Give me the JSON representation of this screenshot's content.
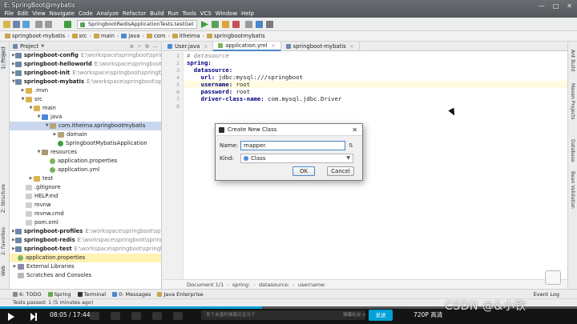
{
  "window": {
    "title": "E: SpringBoot@mybatis",
    "controls": [
      "—",
      "□",
      "✕"
    ]
  },
  "menu": [
    "File",
    "Edit",
    "View",
    "Navigate",
    "Code",
    "Analyze",
    "Refactor",
    "Build",
    "Run",
    "Tools",
    "VCS",
    "Window",
    "Help"
  ],
  "toolbar": {
    "run_config": "SpringbootRedisApplicationTests.testGet"
  },
  "breadcrumb": [
    "springboot-mybatis",
    "src",
    "main",
    "java",
    "com",
    "itheima",
    "springbootmybatis"
  ],
  "left_strip": {
    "project": "1: Project",
    "structure": "Z: Structure",
    "favorites": "2: Favorites",
    "web": "Web"
  },
  "right_strip": {
    "ant": "Ant Build",
    "maven": "Maven Projects",
    "database": "Database",
    "bean": "Bean Validation"
  },
  "project_panel": {
    "header": "Project",
    "tools": [
      "⊕",
      "÷",
      "⚙",
      "—"
    ],
    "rows": [
      {
        "indent": 0,
        "arrow": "▶",
        "icon": "mod",
        "name": "springboot-config",
        "path": "E:\\workspace\\springboot\\springboot",
        "bold": true
      },
      {
        "indent": 0,
        "arrow": "▶",
        "icon": "mod",
        "name": "springboot-helloworld",
        "path": "E:\\workspace\\springboot\\spr",
        "bold": true
      },
      {
        "indent": 0,
        "arrow": "▶",
        "icon": "mod",
        "name": "springboot-init",
        "path": "E:\\workspace\\springboot\\springboot-i",
        "bold": true
      },
      {
        "indent": 0,
        "arrow": "▼",
        "icon": "mod",
        "name": "springboot-mybatis",
        "path": "E:\\workspace\\springboot\\springb",
        "bold": true
      },
      {
        "indent": 1,
        "arrow": "▶",
        "icon": "folder",
        "name": ".mvn",
        "path": ""
      },
      {
        "indent": 1,
        "arrow": "▼",
        "icon": "folder",
        "name": "src",
        "path": ""
      },
      {
        "indent": 2,
        "arrow": "▼",
        "icon": "folder",
        "name": "main",
        "path": ""
      },
      {
        "indent": 3,
        "arrow": "▼",
        "icon": "src",
        "name": "java",
        "path": ""
      },
      {
        "indent": 4,
        "arrow": "▼",
        "icon": "pkg",
        "name": "com.itheima.springbootmybatis",
        "path": "",
        "selected": true
      },
      {
        "indent": 5,
        "arrow": "▶",
        "icon": "pkg",
        "name": "domain",
        "path": ""
      },
      {
        "indent": 5,
        "arrow": "",
        "icon": "cls",
        "name": "SpringbootMybatisApplication",
        "path": ""
      },
      {
        "indent": 3,
        "arrow": "▼",
        "icon": "res",
        "name": "resources",
        "path": ""
      },
      {
        "indent": 4,
        "arrow": "",
        "icon": "leaf",
        "name": "application.properties",
        "path": ""
      },
      {
        "indent": 4,
        "arrow": "",
        "icon": "leaf",
        "name": "application.yml",
        "path": ""
      },
      {
        "indent": 2,
        "arrow": "▶",
        "icon": "folder",
        "name": "test",
        "path": ""
      },
      {
        "indent": 1,
        "arrow": "",
        "icon": "file",
        "name": ".gitignore",
        "path": ""
      },
      {
        "indent": 1,
        "arrow": "",
        "icon": "file",
        "name": "HELP.md",
        "path": ""
      },
      {
        "indent": 1,
        "arrow": "",
        "icon": "file",
        "name": "mvnw",
        "path": ""
      },
      {
        "indent": 1,
        "arrow": "",
        "icon": "file",
        "name": "mvnw.cmd",
        "path": ""
      },
      {
        "indent": 1,
        "arrow": "",
        "icon": "file",
        "name": "pom.xml",
        "path": ""
      },
      {
        "indent": 0,
        "arrow": "▶",
        "icon": "mod",
        "name": "springboot-profiles",
        "path": "E:\\workspace\\springboot\\spring",
        "bold": true
      },
      {
        "indent": 0,
        "arrow": "▶",
        "icon": "mod",
        "name": "springboot-redis",
        "path": "E:\\workspace\\springboot\\springboo",
        "bold": true
      },
      {
        "indent": 0,
        "arrow": "▶",
        "icon": "mod",
        "name": "springboot-test",
        "path": "E:\\workspace\\springboot\\springboo",
        "bold": true
      },
      {
        "indent": 0,
        "arrow": "",
        "icon": "leaf",
        "name": "application.properties",
        "path": "",
        "highlight": true
      },
      {
        "indent": 0,
        "arrow": "▶",
        "icon": "lib",
        "name": "External Libraries",
        "path": ""
      },
      {
        "indent": 0,
        "arrow": "",
        "icon": "scr",
        "name": "Scratches and Consoles",
        "path": ""
      }
    ]
  },
  "editor": {
    "tabs": [
      {
        "label": "User.java",
        "icon_color": "#4a8ad9",
        "active": false
      },
      {
        "label": "application.yml",
        "icon_color": "#7ab45a",
        "active": true
      },
      {
        "label": "springboot-mybatis",
        "icon_color": "#6f86a8",
        "active": false
      }
    ],
    "line_numbers": [
      "1",
      "2",
      "3",
      "4",
      "5",
      "6",
      "7",
      "8"
    ],
    "lines": [
      {
        "indent": "",
        "key": "",
        "val": "# datasource",
        "comment": true
      },
      {
        "indent": "",
        "key": "spring:",
        "val": ""
      },
      {
        "indent": "  ",
        "key": "datasource:",
        "val": ""
      },
      {
        "indent": "    ",
        "key": "url:",
        "val": " jdbc:mysql:///springboot"
      },
      {
        "indent": "    ",
        "key": "username:",
        "val": " root"
      },
      {
        "indent": "    ",
        "key": "password:",
        "val": " root"
      },
      {
        "indent": "    ",
        "key": "driver-class-name:",
        "val": " com.mysql.jdbc.Driver"
      },
      {
        "indent": "",
        "key": "",
        "val": ""
      }
    ],
    "breadcrumb": [
      "Document 1/1",
      "spring:",
      "datasource:",
      "username:"
    ]
  },
  "dialog": {
    "title": "Create New Class",
    "name_label": "Name:",
    "name_value": "mapper.",
    "sort_glyph": "⇅",
    "kind_label": "Kind:",
    "kind_value": "Class",
    "ok_label": "OK",
    "cancel_label": "Cancel",
    "close_glyph": "✕"
  },
  "bottom_tabs": [
    "6: TODO",
    "Spring",
    "Terminal",
    "0: Messages",
    "Java Enterprise"
  ],
  "event_log": "Event Log",
  "status_text": "Tests passed: 1 (5 minutes ago)",
  "video": {
    "time": "08:05 / 17:44",
    "progress": 0.454,
    "danmaku_placeholder": "发个友善的弹幕见证当下",
    "etiquette": "弹幕礼仪 >",
    "send": "发送",
    "quality": "720P 高清",
    "watermark": "CSDN @&小钦"
  }
}
